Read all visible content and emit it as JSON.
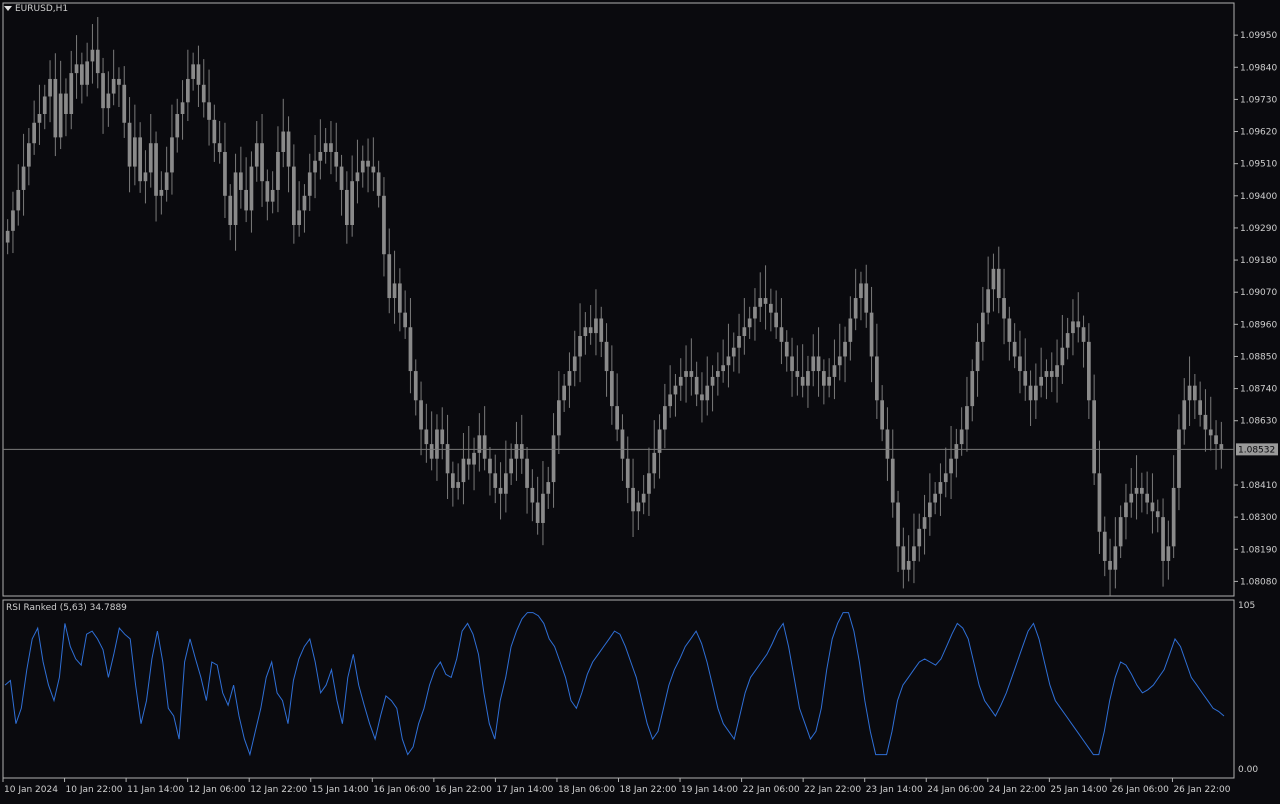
{
  "window": {
    "symbol_label": "EURUSD,H1",
    "menu_icon": "triangle-down-icon"
  },
  "colors": {
    "background": "#0a0a0e",
    "candle": "#8a8a8a",
    "candle_wick": "#7a7a7a",
    "grid_line": "#c8c8c8",
    "axis_text": "#cfcfcf",
    "price_line": "#7a7a7a",
    "price_tag_bg": "#9a9a9a",
    "price_tag_text": "#0a0a0e",
    "rsi_line": "#2f6fd6",
    "border": "#b0b0b0"
  },
  "indicator": {
    "label": "RSI Ranked (5,63) 34.7889",
    "scale_top": "105",
    "scale_bottom": "0.00"
  },
  "price_axis": {
    "ticks": [
      "1.09950",
      "1.09840",
      "1.09730",
      "1.09620",
      "1.09510",
      "1.09400",
      "1.09290",
      "1.09180",
      "1.09070",
      "1.08960",
      "1.08850",
      "1.08740",
      "1.08630",
      "1.08410",
      "1.08300",
      "1.08190",
      "1.08080"
    ],
    "current_price": "1.08532"
  },
  "time_axis": {
    "ticks": [
      "10 Jan 2024",
      "10 Jan 22:00",
      "11 Jan 14:00",
      "12 Jan 06:00",
      "12 Jan 22:00",
      "15 Jan 14:00",
      "16 Jan 06:00",
      "16 Jan 22:00",
      "17 Jan 14:00",
      "18 Jan 06:00",
      "18 Jan 22:00",
      "19 Jan 14:00",
      "22 Jan 06:00",
      "22 Jan 22:00",
      "23 Jan 14:00",
      "24 Jan 06:00",
      "24 Jan 22:00",
      "25 Jan 14:00",
      "26 Jan 06:00",
      "26 Jan 22:00"
    ]
  },
  "chart_data": [
    {
      "type": "candlestick",
      "title": "EURUSD,H1",
      "ylim": [
        1.0803,
        1.1006
      ],
      "current_price": 1.08532,
      "closes": [
        1.0928,
        1.0935,
        1.0942,
        1.095,
        1.0958,
        1.0965,
        1.0968,
        1.0974,
        1.098,
        1.096,
        1.0975,
        1.0968,
        1.0982,
        1.0985,
        1.0978,
        1.0986,
        1.099,
        1.0982,
        1.097,
        1.0975,
        1.098,
        1.0978,
        1.0965,
        1.095,
        1.096,
        1.0945,
        1.0948,
        1.0958,
        1.094,
        1.0942,
        1.0948,
        1.096,
        1.0968,
        1.0972,
        1.098,
        1.0985,
        1.0978,
        1.0972,
        1.0966,
        1.0958,
        1.0955,
        1.094,
        1.093,
        1.0948,
        1.0942,
        1.0935,
        1.095,
        1.0958,
        1.0945,
        1.0938,
        1.0942,
        1.0955,
        1.0962,
        1.095,
        1.093,
        1.0935,
        1.094,
        1.0948,
        1.0952,
        1.0955,
        1.0958,
        1.0955,
        1.095,
        1.0942,
        1.093,
        1.0945,
        1.0948,
        1.0952,
        1.095,
        1.0948,
        1.094,
        1.092,
        1.0905,
        1.091,
        1.09,
        1.0895,
        1.088,
        1.087,
        1.086,
        1.0855,
        1.085,
        1.086,
        1.0855,
        1.0845,
        1.084,
        1.0842,
        1.085,
        1.0848,
        1.0852,
        1.0858,
        1.085,
        1.0845,
        1.084,
        1.0838,
        1.0845,
        1.085,
        1.0855,
        1.085,
        1.084,
        1.0835,
        1.0828,
        1.0838,
        1.0842,
        1.0858,
        1.087,
        1.0875,
        1.088,
        1.0885,
        1.0892,
        1.0895,
        1.0893,
        1.0898,
        1.089,
        1.088,
        1.0868,
        1.086,
        1.085,
        1.084,
        1.0832,
        1.0835,
        1.0838,
        1.0845,
        1.0852,
        1.086,
        1.0868,
        1.0872,
        1.0875,
        1.0878,
        1.088,
        1.0878,
        1.0872,
        1.087,
        1.0875,
        1.0878,
        1.088,
        1.0882,
        1.0885,
        1.0888,
        1.0892,
        1.0895,
        1.0898,
        1.0902,
        1.0905,
        1.0903,
        1.09,
        1.0895,
        1.089,
        1.0885,
        1.088,
        1.0878,
        1.0875,
        1.088,
        1.0885,
        1.088,
        1.0875,
        1.0878,
        1.0882,
        1.0885,
        1.089,
        1.0898,
        1.0905,
        1.091,
        1.09,
        1.0885,
        1.087,
        1.086,
        1.085,
        1.0835,
        1.082,
        1.0812,
        1.0815,
        1.082,
        1.0826,
        1.083,
        1.0835,
        1.0838,
        1.0842,
        1.0845,
        1.085,
        1.0855,
        1.086,
        1.0868,
        1.088,
        1.089,
        1.09,
        1.0908,
        1.0915,
        1.0905,
        1.0898,
        1.089,
        1.0885,
        1.088,
        1.0875,
        1.087,
        1.0875,
        1.0878,
        1.088,
        1.0878,
        1.0882,
        1.0888,
        1.0893,
        1.0897,
        1.0895,
        1.089,
        1.087,
        1.0845,
        1.0825,
        1.0815,
        1.0812,
        1.082,
        1.083,
        1.0835,
        1.0838,
        1.084,
        1.0838,
        1.0835,
        1.0832,
        1.083,
        1.0815,
        1.082,
        1.084,
        1.086,
        1.087,
        1.0875,
        1.087,
        1.0865,
        1.086,
        1.0858,
        1.0855,
        1.0853
      ],
      "xlabel": "",
      "ylabel": ""
    },
    {
      "type": "line",
      "title": "RSI Ranked (5,63) 34.7889",
      "ylim": [
        0,
        105
      ],
      "series": [
        {
          "values": [
            55,
            58,
            30,
            40,
            65,
            85,
            92,
            70,
            55,
            45,
            60,
            95,
            80,
            72,
            68,
            88,
            90,
            85,
            78,
            60,
            75,
            92,
            88,
            85,
            55,
            30,
            45,
            72,
            90,
            70,
            40,
            35,
            20,
            70,
            85,
            72,
            60,
            45,
            70,
            68,
            50,
            42,
            55,
            35,
            20,
            10,
            25,
            40,
            60,
            70,
            50,
            45,
            30,
            58,
            72,
            80,
            85,
            70,
            50,
            55,
            65,
            45,
            30,
            60,
            75,
            55,
            42,
            30,
            20,
            35,
            48,
            45,
            40,
            20,
            10,
            15,
            30,
            40,
            55,
            65,
            70,
            62,
            60,
            72,
            90,
            95,
            88,
            75,
            50,
            30,
            20,
            45,
            60,
            80,
            90,
            98,
            102,
            102,
            100,
            95,
            85,
            80,
            70,
            60,
            45,
            40,
            50,
            62,
            70,
            75,
            80,
            85,
            90,
            88,
            80,
            70,
            60,
            45,
            30,
            20,
            25,
            40,
            55,
            65,
            72,
            80,
            85,
            90,
            82,
            70,
            55,
            40,
            30,
            25,
            20,
            35,
            50,
            60,
            65,
            70,
            75,
            82,
            90,
            95,
            80,
            60,
            40,
            30,
            20,
            25,
            40,
            65,
            85,
            95,
            102,
            102,
            90,
            70,
            45,
            25,
            10,
            10,
            10,
            25,
            45,
            55,
            60,
            65,
            70,
            72,
            70,
            68,
            72,
            80,
            88,
            95,
            92,
            85,
            70,
            55,
            45,
            40,
            35,
            42,
            50,
            60,
            70,
            80,
            90,
            95,
            85,
            70,
            55,
            45,
            40,
            35,
            30,
            25,
            20,
            15,
            10,
            10,
            25,
            45,
            60,
            70,
            68,
            62,
            55,
            50,
            52,
            55,
            60,
            65,
            75,
            85,
            80,
            70,
            60,
            55,
            50,
            45,
            40,
            38,
            35
          ],
          "name": ""
        }
      ],
      "xlabel": "",
      "ylabel": ""
    }
  ]
}
